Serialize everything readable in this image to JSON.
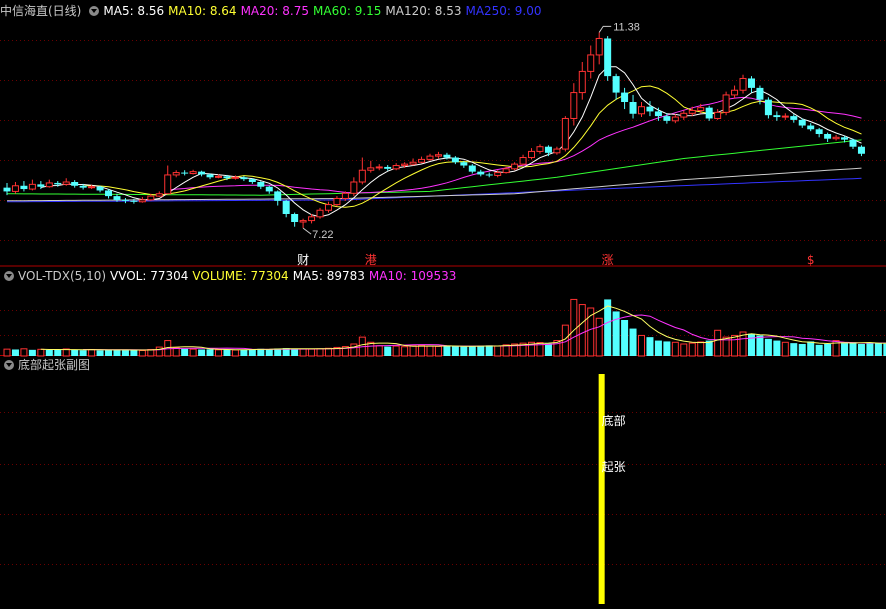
{
  "main_header": {
    "stock": "中信海直(日线)",
    "ma_items": [
      {
        "label": "MA5: 8.56",
        "color": "#ffffff"
      },
      {
        "label": "MA10: 8.64",
        "color": "#ffff33"
      },
      {
        "label": "MA20: 8.75",
        "color": "#ff33ff"
      },
      {
        "label": "MA60: 9.15",
        "color": "#33ff33"
      },
      {
        "label": "MA120: 8.53",
        "color": "#cccccc"
      },
      {
        "label": "MA250: 9.00",
        "color": "#3333ff"
      }
    ]
  },
  "vol_header": {
    "indicator": "VOL-TDX(5,10)",
    "items": [
      {
        "label": "VVOL: 77304",
        "color": "#ffffff"
      },
      {
        "label": "VOLUME: 77304",
        "color": "#ffff33"
      },
      {
        "label": "MA5: 89783",
        "color": "#ffffff"
      },
      {
        "label": "MA10: 109533",
        "color": "#ff33ff"
      }
    ]
  },
  "sub_header": {
    "indicator": "底部起张副图"
  },
  "chart_data": [
    {
      "type": "candlestick",
      "title": "中信海直(日线)",
      "price_range": [
        6.5,
        11.6
      ],
      "max_label": "11.38",
      "min_label": "7.22",
      "candles": [
        [
          8.08,
          8.0,
          8.18,
          7.92
        ],
        [
          8.0,
          8.12,
          8.2,
          7.95
        ],
        [
          8.12,
          8.05,
          8.22,
          8.0
        ],
        [
          8.05,
          8.15,
          8.25,
          8.02
        ],
        [
          8.15,
          8.1,
          8.22,
          8.05
        ],
        [
          8.1,
          8.18,
          8.25,
          8.08
        ],
        [
          8.18,
          8.15,
          8.22,
          8.1
        ],
        [
          8.15,
          8.2,
          8.28,
          8.12
        ],
        [
          8.2,
          8.12,
          8.24,
          8.08
        ],
        [
          8.12,
          8.08,
          8.16,
          8.04
        ],
        [
          8.08,
          8.1,
          8.14,
          8.05
        ],
        [
          8.1,
          8.02,
          8.12,
          7.98
        ],
        [
          8.02,
          7.9,
          8.05,
          7.85
        ],
        [
          7.9,
          7.82,
          7.95,
          7.78
        ],
        [
          7.82,
          7.8,
          7.86,
          7.75
        ],
        [
          7.8,
          7.78,
          7.84,
          7.74
        ],
        [
          7.78,
          7.82,
          7.88,
          7.76
        ],
        [
          7.82,
          7.9,
          7.95,
          7.8
        ],
        [
          7.9,
          7.95,
          8.0,
          7.88
        ],
        [
          7.95,
          8.35,
          8.55,
          7.95
        ],
        [
          8.35,
          8.4,
          8.45,
          8.3
        ],
        [
          8.4,
          8.38,
          8.45,
          8.34
        ],
        [
          8.38,
          8.42,
          8.46,
          8.36
        ],
        [
          8.42,
          8.36,
          8.44,
          8.32
        ],
        [
          8.36,
          8.3,
          8.38,
          8.26
        ],
        [
          8.3,
          8.32,
          8.36,
          8.28
        ],
        [
          8.32,
          8.28,
          8.35,
          8.24
        ],
        [
          8.28,
          8.3,
          8.34,
          8.25
        ],
        [
          8.3,
          8.26,
          8.33,
          8.22
        ],
        [
          8.26,
          8.2,
          8.28,
          8.16
        ],
        [
          8.2,
          8.1,
          8.22,
          8.05
        ],
        [
          8.1,
          8.0,
          8.12,
          7.95
        ],
        [
          8.0,
          7.8,
          8.02,
          7.7
        ],
        [
          7.8,
          7.52,
          7.82,
          7.45
        ],
        [
          7.52,
          7.35,
          7.55,
          7.25
        ],
        [
          7.35,
          7.38,
          7.42,
          7.22
        ],
        [
          7.38,
          7.46,
          7.52,
          7.32
        ],
        [
          7.46,
          7.6,
          7.65,
          7.42
        ],
        [
          7.6,
          7.72,
          7.78,
          7.55
        ],
        [
          7.72,
          7.85,
          7.9,
          7.68
        ],
        [
          7.85,
          7.96,
          8.0,
          7.8
        ],
        [
          7.96,
          8.2,
          8.3,
          7.9
        ],
        [
          8.2,
          8.45,
          8.72,
          8.15
        ],
        [
          8.45,
          8.5,
          8.65,
          8.4
        ],
        [
          8.5,
          8.52,
          8.58,
          8.45
        ],
        [
          8.52,
          8.48,
          8.56,
          8.44
        ],
        [
          8.48,
          8.55,
          8.6,
          8.45
        ],
        [
          8.55,
          8.58,
          8.62,
          8.5
        ],
        [
          8.58,
          8.62,
          8.7,
          8.55
        ],
        [
          8.62,
          8.68,
          8.74,
          8.6
        ],
        [
          8.68,
          8.75,
          8.8,
          8.65
        ],
        [
          8.75,
          8.78,
          8.84,
          8.7
        ],
        [
          8.78,
          8.72,
          8.82,
          8.68
        ],
        [
          8.72,
          8.62,
          8.75,
          8.58
        ],
        [
          8.62,
          8.55,
          8.65,
          8.5
        ],
        [
          8.55,
          8.42,
          8.58,
          8.38
        ],
        [
          8.42,
          8.36,
          8.46,
          8.32
        ],
        [
          8.36,
          8.34,
          8.4,
          8.3
        ],
        [
          8.34,
          8.4,
          8.45,
          8.3
        ],
        [
          8.4,
          8.48,
          8.52,
          8.38
        ],
        [
          8.48,
          8.58,
          8.62,
          8.45
        ],
        [
          8.58,
          8.72,
          8.78,
          8.55
        ],
        [
          8.72,
          8.85,
          8.92,
          8.68
        ],
        [
          8.85,
          8.95,
          9.0,
          8.8
        ],
        [
          8.95,
          8.82,
          8.98,
          8.75
        ],
        [
          8.82,
          8.9,
          8.95,
          8.78
        ],
        [
          8.9,
          9.55,
          9.6,
          8.85
        ],
        [
          9.55,
          10.1,
          10.3,
          9.4
        ],
        [
          10.1,
          10.55,
          10.75,
          9.95
        ],
        [
          10.55,
          10.9,
          11.1,
          10.4
        ],
        [
          10.9,
          11.25,
          11.38,
          10.7
        ],
        [
          11.25,
          10.45,
          11.3,
          10.35
        ],
        [
          10.45,
          10.1,
          10.5,
          9.95
        ],
        [
          10.1,
          9.9,
          10.2,
          9.75
        ],
        [
          9.9,
          9.65,
          10.05,
          9.55
        ],
        [
          9.65,
          9.8,
          9.9,
          9.58
        ],
        [
          9.8,
          9.7,
          9.92,
          9.6
        ],
        [
          9.7,
          9.6,
          9.78,
          9.5
        ],
        [
          9.6,
          9.5,
          9.66,
          9.44
        ],
        [
          9.5,
          9.58,
          9.64,
          9.45
        ],
        [
          9.58,
          9.66,
          9.72,
          9.52
        ],
        [
          9.66,
          9.72,
          9.8,
          9.6
        ],
        [
          9.72,
          9.78,
          9.86,
          9.66
        ],
        [
          9.78,
          9.55,
          9.82,
          9.5
        ],
        [
          9.55,
          9.68,
          9.75,
          9.52
        ],
        [
          9.68,
          10.05,
          10.12,
          9.62
        ],
        [
          10.05,
          10.15,
          10.25,
          9.98
        ],
        [
          10.15,
          10.4,
          10.48,
          10.08
        ],
        [
          10.4,
          10.2,
          10.45,
          10.1
        ],
        [
          10.2,
          9.95,
          10.25,
          9.85
        ],
        [
          9.95,
          9.62,
          10.0,
          9.55
        ],
        [
          9.62,
          9.58,
          9.7,
          9.5
        ],
        [
          9.58,
          9.6,
          9.66,
          9.52
        ],
        [
          9.6,
          9.52,
          9.64,
          9.46
        ],
        [
          9.52,
          9.4,
          9.55,
          9.35
        ],
        [
          9.4,
          9.32,
          9.45,
          9.28
        ],
        [
          9.32,
          9.22,
          9.35,
          9.15
        ],
        [
          9.22,
          9.12,
          9.25,
          9.05
        ],
        [
          9.12,
          9.15,
          9.2,
          9.08
        ],
        [
          9.15,
          9.1,
          9.18,
          9.04
        ],
        [
          9.1,
          8.95,
          9.12,
          8.9
        ],
        [
          8.95,
          8.8,
          8.98,
          8.75
        ]
      ],
      "markers": [
        {
          "label": "财",
          "index": 35,
          "color": "#ffffff"
        },
        {
          "label": "港",
          "index": 43,
          "color": "#ff3333"
        },
        {
          "label": "涨",
          "index": 71,
          "color": "#ff3333"
        },
        {
          "label": "$",
          "index": 95,
          "color": "#ff3333"
        }
      ],
      "ma_lines": [
        {
          "name": "MA5",
          "color": "#ffffff",
          "period": 5
        },
        {
          "name": "MA10",
          "color": "#ffff33",
          "period": 10
        },
        {
          "name": "MA20",
          "color": "#ff33ff",
          "period": 20
        },
        {
          "name": "MA60",
          "color": "#33ff33",
          "smooth": [
            [
              0,
              7.95
            ],
            [
              30,
              7.92
            ],
            [
              50,
              8.0
            ],
            [
              65,
              8.3
            ],
            [
              80,
              8.7
            ],
            [
              104,
              9.15
            ]
          ]
        },
        {
          "name": "MA120",
          "color": "#cccccc",
          "smooth": [
            [
              0,
              7.8
            ],
            [
              40,
              7.85
            ],
            [
              60,
              7.95
            ],
            [
              80,
              8.25
            ],
            [
              104,
              8.53
            ]
          ]
        },
        {
          "name": "MA250",
          "color": "#3333ff",
          "smooth": [
            [
              0,
              7.78
            ],
            [
              40,
              7.82
            ],
            [
              70,
              8.05
            ],
            [
              104,
              8.3
            ]
          ]
        }
      ]
    },
    {
      "type": "bar",
      "title": "VOL-TDX(5,10)",
      "volume_range": [
        0,
        420000
      ],
      "volumes": [
        40000,
        38000,
        42000,
        36000,
        39000,
        35000,
        37000,
        41000,
        36000,
        34000,
        38000,
        33000,
        37000,
        35000,
        34000,
        36000,
        32000,
        38000,
        52000,
        90000,
        48000,
        42000,
        40000,
        38000,
        39000,
        36000,
        37000,
        35000,
        38000,
        40000,
        42000,
        39000,
        44000,
        46000,
        43000,
        41000,
        40000,
        42000,
        45000,
        50000,
        55000,
        70000,
        110000,
        80000,
        60000,
        55000,
        58000,
        54000,
        60000,
        62000,
        58000,
        56000,
        60000,
        57000,
        55000,
        58000,
        60000,
        62000,
        58000,
        65000,
        70000,
        75000,
        80000,
        78000,
        72000,
        90000,
        180000,
        330000,
        300000,
        280000,
        220000,
        330000,
        260000,
        210000,
        160000,
        120000,
        110000,
        90000,
        85000,
        80000,
        70000,
        75000,
        82000,
        90000,
        150000,
        110000,
        120000,
        140000,
        130000,
        120000,
        100000,
        90000,
        80000,
        75000,
        70000,
        85000,
        65000,
        70000,
        90000,
        75000,
        80000,
        70000,
        77304,
        75000,
        72000
      ],
      "up": [
        1,
        0,
        1,
        0,
        1,
        0,
        0,
        1,
        0,
        0,
        1,
        0,
        0,
        0,
        0,
        0,
        1,
        1,
        1,
        1,
        1,
        0,
        1,
        0,
        0,
        1,
        0,
        1,
        0,
        0,
        0,
        0,
        0,
        0,
        0,
        1,
        1,
        1,
        1,
        1,
        1,
        1,
        1,
        1,
        1,
        0,
        1,
        1,
        1,
        1,
        1,
        1,
        0,
        0,
        0,
        0,
        0,
        0,
        1,
        1,
        1,
        1,
        1,
        1,
        0,
        1,
        1,
        1,
        1,
        1,
        1,
        0,
        0,
        0,
        0,
        1,
        0,
        0,
        0,
        1,
        1,
        1,
        1,
        0,
        1,
        1,
        1,
        1,
        0,
        0,
        0,
        0,
        1,
        0,
        0,
        0,
        0,
        0,
        1,
        0,
        0,
        0,
        0,
        0
      ]
    },
    {
      "type": "bar",
      "title": "底部起张副图",
      "signal_index": 71,
      "signal_value": 1,
      "labels": [
        "底部",
        "起张"
      ]
    }
  ]
}
